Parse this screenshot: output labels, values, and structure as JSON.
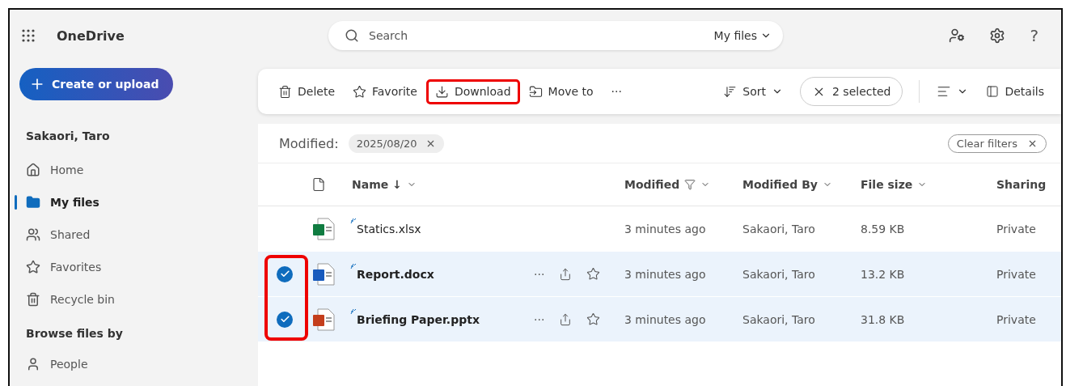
{
  "app": {
    "name": "OneDrive"
  },
  "search": {
    "placeholder": "Search",
    "scope": "My files"
  },
  "header_icons": [
    {
      "kind": "people"
    },
    {
      "kind": "settings"
    },
    {
      "kind": "help",
      "label": "?"
    }
  ],
  "create_button": {
    "label": "Create or upload"
  },
  "sidebar": {
    "user": "Sakaori, Taro",
    "items": [
      {
        "kind": "home",
        "label": "Home",
        "selected": false
      },
      {
        "kind": "folder",
        "label": "My files",
        "selected": true
      },
      {
        "kind": "shared",
        "label": "Shared",
        "selected": false
      },
      {
        "kind": "star",
        "label": "Favorites",
        "selected": false
      },
      {
        "kind": "trash",
        "label": "Recycle bin",
        "selected": false
      }
    ],
    "section": "Browse files by",
    "section_items": [
      {
        "kind": "person",
        "label": "People"
      }
    ]
  },
  "toolbar": {
    "items": [
      {
        "kind": "delete",
        "label": "Delete",
        "highlighted": false
      },
      {
        "kind": "favorite",
        "label": "Favorite",
        "highlighted": false
      },
      {
        "kind": "download",
        "label": "Download",
        "highlighted": true
      },
      {
        "kind": "move",
        "label": "Move to",
        "highlighted": false
      },
      {
        "kind": "more",
        "label": "···",
        "highlighted": false
      }
    ],
    "sort": "Sort",
    "selection": "2 selected",
    "details": "Details"
  },
  "filter": {
    "label": "Modified:",
    "value": "2025/08/20",
    "clear": "Clear filters"
  },
  "table": {
    "columns": [
      "Name ↓",
      "Modified",
      "Modified By",
      "File size",
      "Sharing"
    ],
    "checkbox_highlight": true,
    "rows": [
      {
        "kind": "excel",
        "name": "Statics.xlsx",
        "modified": "3 minutes ago",
        "modified_by": "Sakaori, Taro",
        "size": "8.59 KB",
        "sharing": "Private",
        "selected": false
      },
      {
        "kind": "word",
        "name": "Report.docx",
        "modified": "3 minutes ago",
        "modified_by": "Sakaori, Taro",
        "size": "13.2 KB",
        "sharing": "Private",
        "selected": true
      },
      {
        "kind": "powerpoint",
        "name": "Briefing Paper.pptx",
        "modified": "3 minutes ago",
        "modified_by": "Sakaori, Taro",
        "size": "31.8 KB",
        "sharing": "Private",
        "selected": true
      }
    ],
    "row_actions": "···"
  }
}
